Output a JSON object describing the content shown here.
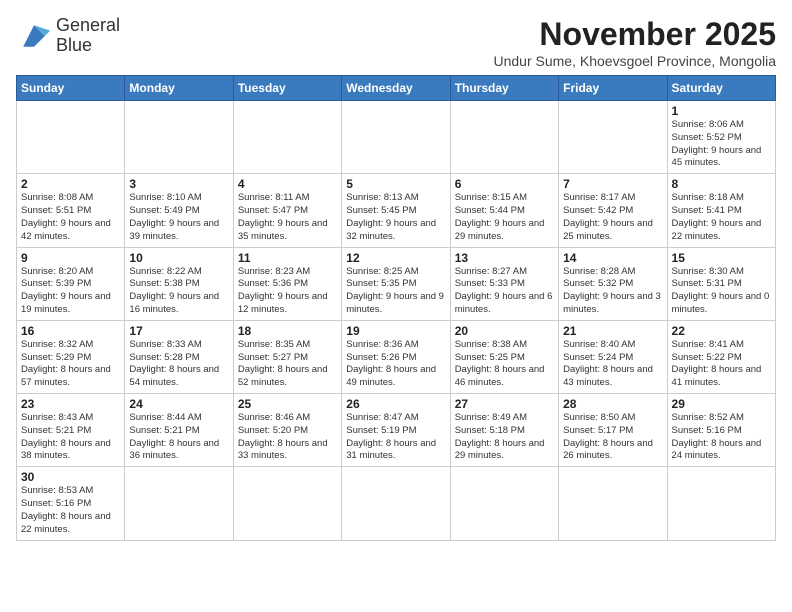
{
  "logo": {
    "line1": "General",
    "line2": "Blue"
  },
  "title": "November 2025",
  "subtitle": "Undur Sume, Khoevsgoel Province, Mongolia",
  "weekdays": [
    "Sunday",
    "Monday",
    "Tuesday",
    "Wednesday",
    "Thursday",
    "Friday",
    "Saturday"
  ],
  "weeks": [
    [
      {
        "day": "",
        "info": ""
      },
      {
        "day": "",
        "info": ""
      },
      {
        "day": "",
        "info": ""
      },
      {
        "day": "",
        "info": ""
      },
      {
        "day": "",
        "info": ""
      },
      {
        "day": "",
        "info": ""
      },
      {
        "day": "1",
        "info": "Sunrise: 8:06 AM\nSunset: 5:52 PM\nDaylight: 9 hours and 45 minutes."
      }
    ],
    [
      {
        "day": "2",
        "info": "Sunrise: 8:08 AM\nSunset: 5:51 PM\nDaylight: 9 hours and 42 minutes."
      },
      {
        "day": "3",
        "info": "Sunrise: 8:10 AM\nSunset: 5:49 PM\nDaylight: 9 hours and 39 minutes."
      },
      {
        "day": "4",
        "info": "Sunrise: 8:11 AM\nSunset: 5:47 PM\nDaylight: 9 hours and 35 minutes."
      },
      {
        "day": "5",
        "info": "Sunrise: 8:13 AM\nSunset: 5:45 PM\nDaylight: 9 hours and 32 minutes."
      },
      {
        "day": "6",
        "info": "Sunrise: 8:15 AM\nSunset: 5:44 PM\nDaylight: 9 hours and 29 minutes."
      },
      {
        "day": "7",
        "info": "Sunrise: 8:17 AM\nSunset: 5:42 PM\nDaylight: 9 hours and 25 minutes."
      },
      {
        "day": "8",
        "info": "Sunrise: 8:18 AM\nSunset: 5:41 PM\nDaylight: 9 hours and 22 minutes."
      }
    ],
    [
      {
        "day": "9",
        "info": "Sunrise: 8:20 AM\nSunset: 5:39 PM\nDaylight: 9 hours and 19 minutes."
      },
      {
        "day": "10",
        "info": "Sunrise: 8:22 AM\nSunset: 5:38 PM\nDaylight: 9 hours and 16 minutes."
      },
      {
        "day": "11",
        "info": "Sunrise: 8:23 AM\nSunset: 5:36 PM\nDaylight: 9 hours and 12 minutes."
      },
      {
        "day": "12",
        "info": "Sunrise: 8:25 AM\nSunset: 5:35 PM\nDaylight: 9 hours and 9 minutes."
      },
      {
        "day": "13",
        "info": "Sunrise: 8:27 AM\nSunset: 5:33 PM\nDaylight: 9 hours and 6 minutes."
      },
      {
        "day": "14",
        "info": "Sunrise: 8:28 AM\nSunset: 5:32 PM\nDaylight: 9 hours and 3 minutes."
      },
      {
        "day": "15",
        "info": "Sunrise: 8:30 AM\nSunset: 5:31 PM\nDaylight: 9 hours and 0 minutes."
      }
    ],
    [
      {
        "day": "16",
        "info": "Sunrise: 8:32 AM\nSunset: 5:29 PM\nDaylight: 8 hours and 57 minutes."
      },
      {
        "day": "17",
        "info": "Sunrise: 8:33 AM\nSunset: 5:28 PM\nDaylight: 8 hours and 54 minutes."
      },
      {
        "day": "18",
        "info": "Sunrise: 8:35 AM\nSunset: 5:27 PM\nDaylight: 8 hours and 52 minutes."
      },
      {
        "day": "19",
        "info": "Sunrise: 8:36 AM\nSunset: 5:26 PM\nDaylight: 8 hours and 49 minutes."
      },
      {
        "day": "20",
        "info": "Sunrise: 8:38 AM\nSunset: 5:25 PM\nDaylight: 8 hours and 46 minutes."
      },
      {
        "day": "21",
        "info": "Sunrise: 8:40 AM\nSunset: 5:24 PM\nDaylight: 8 hours and 43 minutes."
      },
      {
        "day": "22",
        "info": "Sunrise: 8:41 AM\nSunset: 5:22 PM\nDaylight: 8 hours and 41 minutes."
      }
    ],
    [
      {
        "day": "23",
        "info": "Sunrise: 8:43 AM\nSunset: 5:21 PM\nDaylight: 8 hours and 38 minutes."
      },
      {
        "day": "24",
        "info": "Sunrise: 8:44 AM\nSunset: 5:21 PM\nDaylight: 8 hours and 36 minutes."
      },
      {
        "day": "25",
        "info": "Sunrise: 8:46 AM\nSunset: 5:20 PM\nDaylight: 8 hours and 33 minutes."
      },
      {
        "day": "26",
        "info": "Sunrise: 8:47 AM\nSunset: 5:19 PM\nDaylight: 8 hours and 31 minutes."
      },
      {
        "day": "27",
        "info": "Sunrise: 8:49 AM\nSunset: 5:18 PM\nDaylight: 8 hours and 29 minutes."
      },
      {
        "day": "28",
        "info": "Sunrise: 8:50 AM\nSunset: 5:17 PM\nDaylight: 8 hours and 26 minutes."
      },
      {
        "day": "29",
        "info": "Sunrise: 8:52 AM\nSunset: 5:16 PM\nDaylight: 8 hours and 24 minutes."
      }
    ],
    [
      {
        "day": "30",
        "info": "Sunrise: 8:53 AM\nSunset: 5:16 PM\nDaylight: 8 hours and 22 minutes."
      },
      {
        "day": "",
        "info": ""
      },
      {
        "day": "",
        "info": ""
      },
      {
        "day": "",
        "info": ""
      },
      {
        "day": "",
        "info": ""
      },
      {
        "day": "",
        "info": ""
      },
      {
        "day": "",
        "info": ""
      }
    ]
  ]
}
